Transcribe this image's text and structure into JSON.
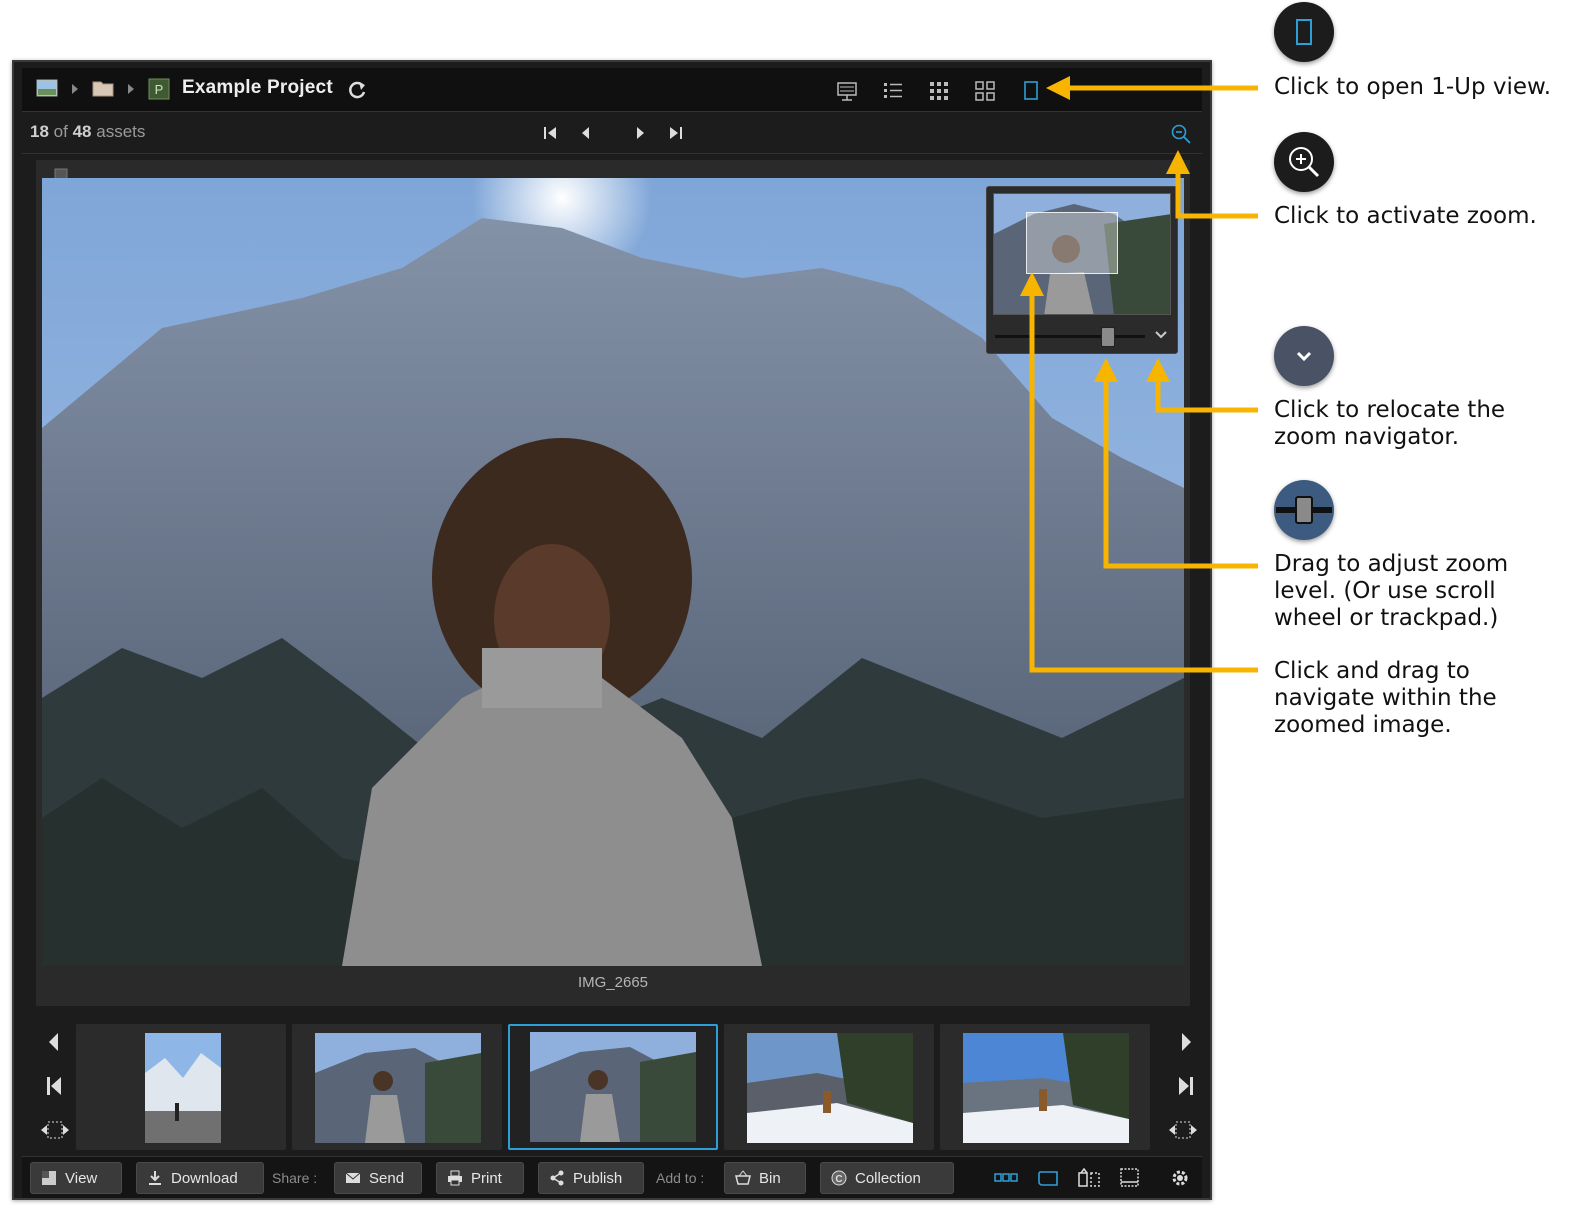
{
  "header": {
    "project_title": "Example Project",
    "project_badge": "P",
    "breadcrumb_icons": [
      "image-icon",
      "folder-icon",
      "project-icon"
    ],
    "view_icons": [
      "table-view-icon",
      "list-view-icon",
      "small-grid-icon",
      "large-grid-icon",
      "one-up-icon"
    ],
    "active_view": "one-up-icon"
  },
  "navigation": {
    "current": "18",
    "of": "of",
    "total": "48",
    "unit": "assets",
    "icons": [
      "first-icon",
      "previous-icon",
      "next-icon",
      "last-icon",
      "zoom-icon"
    ]
  },
  "viewer": {
    "filename": "IMG_2665",
    "zoom_level": 0.78
  },
  "filmstrip": {
    "selected_index": 2,
    "count": 5
  },
  "bottombar": {
    "view_label": "View",
    "download_label": "Download",
    "share_label": "Share :",
    "send_label": "Send",
    "print_label": "Print",
    "publish_label": "Publish",
    "add_to_label": "Add to :",
    "bin_label": "Bin",
    "collection_label": "Collection"
  },
  "annotations": {
    "one_up": "Click to open 1-Up view.",
    "zoom": "Click to activate zoom.",
    "relocate": "Click to relocate the\nzoom navigator.",
    "slider": "Drag to adjust zoom\nlevel. (Or use scroll\nwheel or trackpad.)",
    "navigate": "Click and drag to\nnavigate within the\nzoomed image."
  },
  "colors": {
    "accent": "#2e9fd6",
    "callout": "#f7b500",
    "window_bg": "#1c1c1c"
  }
}
